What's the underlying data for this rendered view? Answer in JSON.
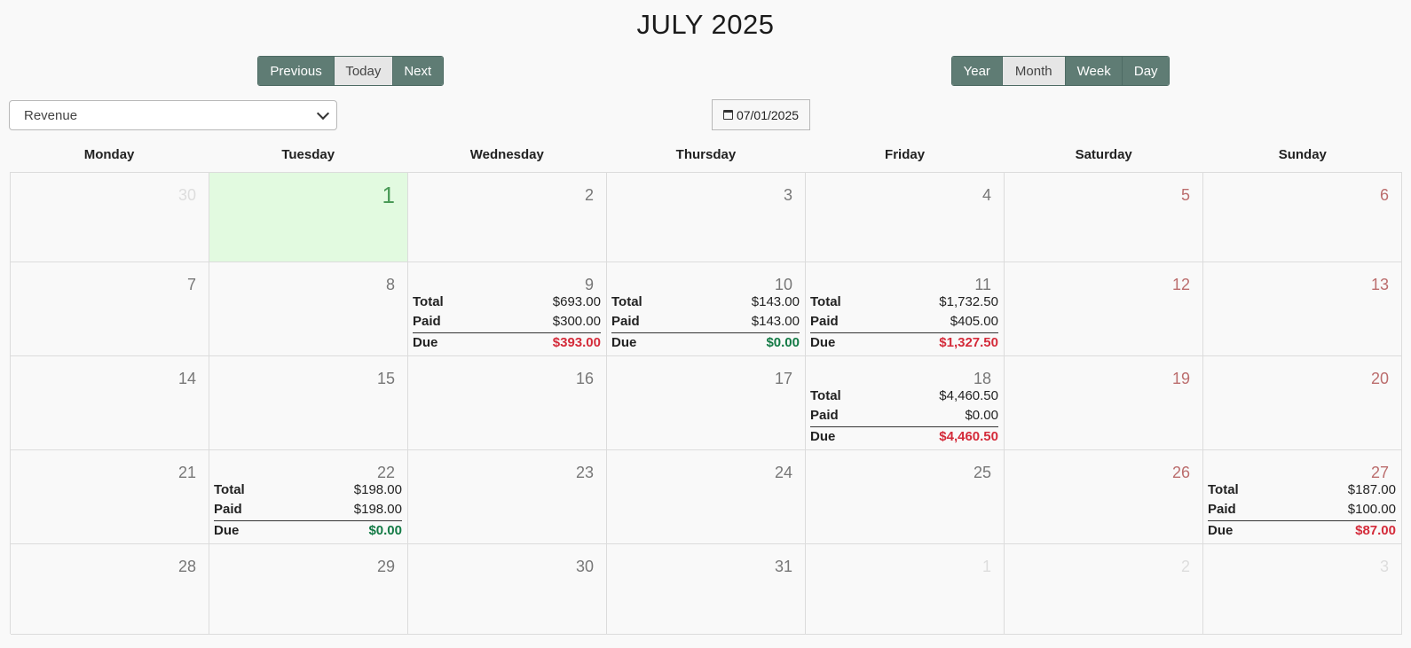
{
  "header": {
    "title": "JULY 2025"
  },
  "nav": {
    "previous": "Previous",
    "today": "Today",
    "next": "Next"
  },
  "views": {
    "year": "Year",
    "month": "Month",
    "week": "Week",
    "day": "Day"
  },
  "filter": {
    "selected": "Revenue"
  },
  "date_picker": {
    "value": "07/01/2025"
  },
  "labels": {
    "total": "Total",
    "paid": "Paid",
    "due": "Due"
  },
  "weekdays": [
    "Monday",
    "Tuesday",
    "Wednesday",
    "Thursday",
    "Friday",
    "Saturday",
    "Sunday"
  ],
  "colors": {
    "due_positive": "#d42b3a",
    "due_zero": "#137a45",
    "today_bg": "#e2fae0",
    "button": "#5f7c74"
  },
  "weeks": [
    [
      {
        "day": "30",
        "other": true
      },
      {
        "day": "1",
        "today": true
      },
      {
        "day": "2"
      },
      {
        "day": "3"
      },
      {
        "day": "4"
      },
      {
        "day": "5",
        "weekend": true
      },
      {
        "day": "6",
        "weekend": true
      }
    ],
    [
      {
        "day": "7"
      },
      {
        "day": "8"
      },
      {
        "day": "9",
        "total": "$693.00",
        "paid": "$300.00",
        "due": "$393.00",
        "due_status": "red"
      },
      {
        "day": "10",
        "total": "$143.00",
        "paid": "$143.00",
        "due": "$0.00",
        "due_status": "green"
      },
      {
        "day": "11",
        "total": "$1,732.50",
        "paid": "$405.00",
        "due": "$1,327.50",
        "due_status": "red"
      },
      {
        "day": "12",
        "weekend": true
      },
      {
        "day": "13",
        "weekend": true
      }
    ],
    [
      {
        "day": "14"
      },
      {
        "day": "15"
      },
      {
        "day": "16"
      },
      {
        "day": "17"
      },
      {
        "day": "18",
        "total": "$4,460.50",
        "paid": "$0.00",
        "due": "$4,460.50",
        "due_status": "red"
      },
      {
        "day": "19",
        "weekend": true
      },
      {
        "day": "20",
        "weekend": true
      }
    ],
    [
      {
        "day": "21"
      },
      {
        "day": "22",
        "total": "$198.00",
        "paid": "$198.00",
        "due": "$0.00",
        "due_status": "green"
      },
      {
        "day": "23"
      },
      {
        "day": "24"
      },
      {
        "day": "25"
      },
      {
        "day": "26",
        "weekend": true
      },
      {
        "day": "27",
        "weekend": true,
        "total": "$187.00",
        "paid": "$100.00",
        "due": "$87.00",
        "due_status": "red"
      }
    ],
    [
      {
        "day": "28"
      },
      {
        "day": "29"
      },
      {
        "day": "30"
      },
      {
        "day": "31"
      },
      {
        "day": "1",
        "other": true
      },
      {
        "day": "2",
        "other": true
      },
      {
        "day": "3",
        "other": true
      }
    ]
  ]
}
